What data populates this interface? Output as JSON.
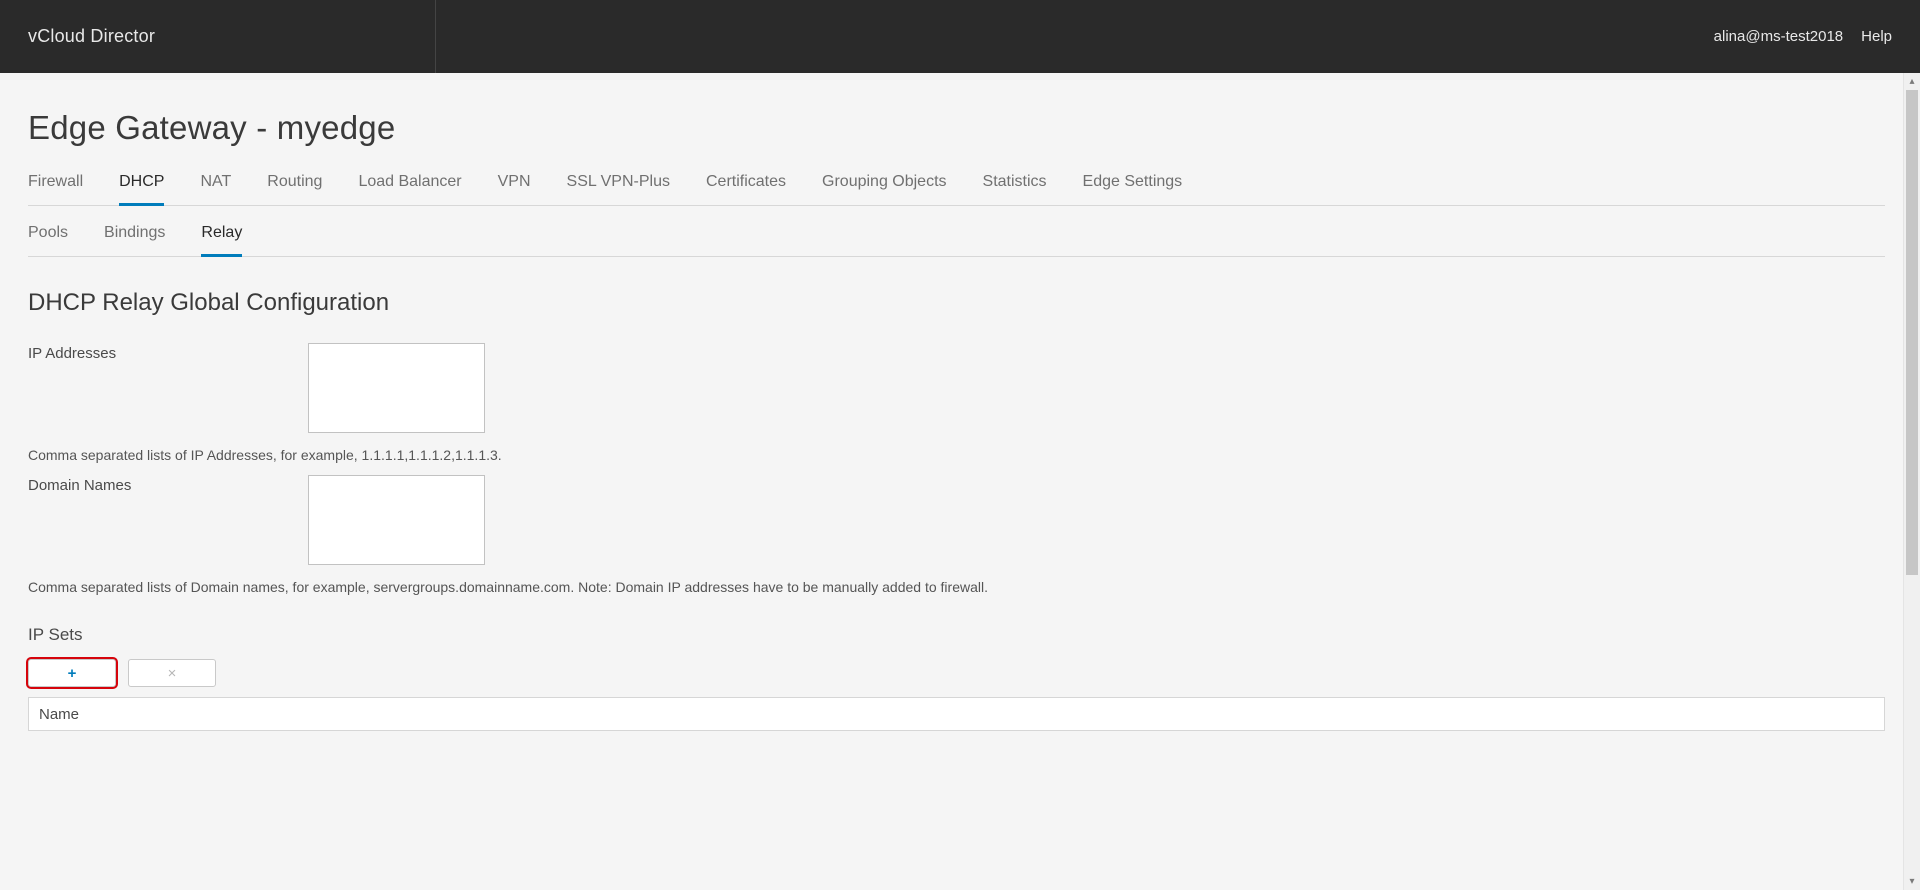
{
  "brand": "vCloud Director",
  "user": "alina@ms-test2018",
  "help_label": "Help",
  "page_title": "Edge Gateway - myedge",
  "tabs": {
    "firewall": "Firewall",
    "dhcp": "DHCP",
    "nat": "NAT",
    "routing": "Routing",
    "load_balancer": "Load Balancer",
    "vpn": "VPN",
    "ssl_vpn_plus": "SSL VPN-Plus",
    "certificates": "Certificates",
    "grouping_objects": "Grouping Objects",
    "statistics": "Statistics",
    "edge_settings": "Edge Settings"
  },
  "subtabs": {
    "pools": "Pools",
    "bindings": "Bindings",
    "relay": "Relay"
  },
  "section_title": "DHCP Relay Global Configuration",
  "form": {
    "ip_addresses_label": "IP Addresses",
    "ip_addresses_value": "",
    "ip_addresses_help": "Comma separated lists of IP Addresses, for example, 1.1.1.1,1.1.1.2,1.1.1.3.",
    "domain_names_label": "Domain Names",
    "domain_names_value": "",
    "domain_names_help": "Comma separated lists of Domain names, for example, servergroups.domainname.com. Note: Domain IP addresses have to be manually added to firewall."
  },
  "ip_sets": {
    "title": "IP Sets",
    "add_glyph": "+",
    "remove_glyph": "×",
    "col_name": "Name"
  }
}
